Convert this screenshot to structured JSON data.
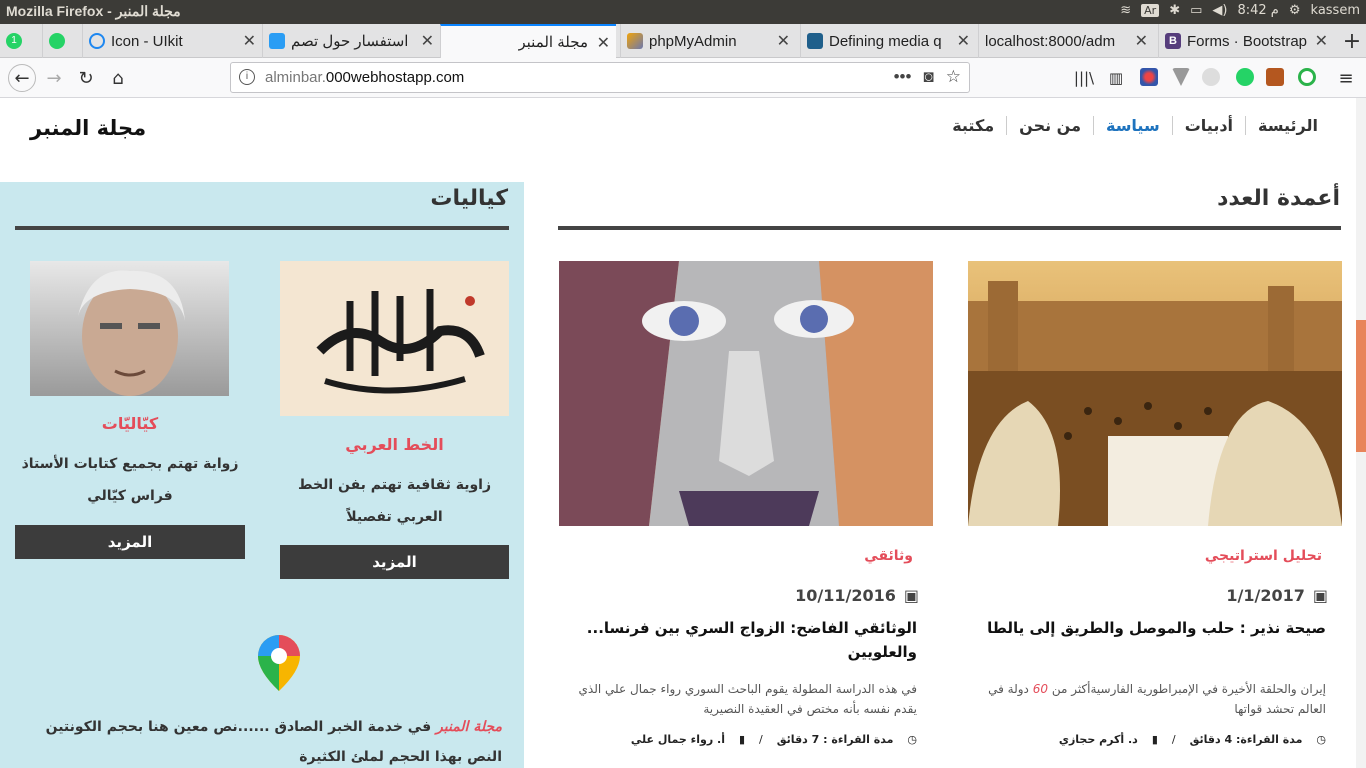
{
  "os": {
    "window_title": "Mozilla Firefox - مجلة المنبر",
    "keyboard": "Ar",
    "time": "8:42 م",
    "user": "kassem"
  },
  "tabs": [
    {
      "label": "",
      "color": "#25d366"
    },
    {
      "label": "",
      "color": "#25d366"
    },
    {
      "label": "Icon - UIkit",
      "color": "#1e87f0"
    },
    {
      "label": "استفسار حول تصم",
      "color": "#2a9df4"
    },
    {
      "label": "مجلة المنبر",
      "color": "#f9f9fa"
    },
    {
      "label": "phpMyAdmin",
      "color": "#f0a30a"
    },
    {
      "label": "Defining media q",
      "color": "#1f5f8b"
    },
    {
      "label": "localhost:8000/adm",
      "color": "#e3e3e4"
    },
    {
      "label": "Forms · Bootstrap",
      "color": "#563d7c"
    }
  ],
  "url": {
    "prefix": "alminbar.",
    "domain": "000webhostapp.com"
  },
  "site": {
    "logo": "مجلة المنبر",
    "menu": [
      "الرئيسة",
      "أدبيات",
      "سياسة",
      "من نحن",
      "مكتبة"
    ],
    "active_menu": "سياسة"
  },
  "sidebar": {
    "title": "كياليات",
    "cards": [
      {
        "title": "الخط العربي",
        "desc": "زاوية ثقافية تهتم بفن الخط العربي تفصيلاً",
        "more": "المزيد"
      },
      {
        "title": "كيّاليّات",
        "desc": "زواية تهتم بجميع كتابات الأستاذ فراس كيّالي",
        "more": "المزيد"
      }
    ],
    "footer_brand": "مجلة المنبر",
    "footer_text": " في خدمة الخبر الصادق ......نص معين هنا بحجم الكونتين النص بهذا الحجم لملئ الكثيرة"
  },
  "main": {
    "title": "أعمدة العدد",
    "posts": [
      {
        "category": "تحليل استراتيجي",
        "date": "1/1/2017",
        "title": "صيحة نذير : حلب والموصل والطريق إلى يالطا",
        "excerpt_pre": "إيران والحلقة الأخيرة في الإمبراطورية الفارسيةأكثر من ",
        "excerpt_num": "60",
        "excerpt_post": " دولة في العالم تحشد قواتها",
        "read_time": "مدة القراءة: 4 دقائق",
        "author": "د. أكرم حجازي",
        "sep": "/"
      },
      {
        "category": "وثائقي",
        "date": "10/11/2016",
        "title": "الوثائقي الفاضح: الزواج السري بين فرنسا... والعلويين",
        "excerpt_pre": "في هذه الدراسة المطولة يقوم الباحث السوري رواء جمال علي الذي يقدم نفسه بأنه مختص في العقيدة النصيرية",
        "excerpt_num": "",
        "excerpt_post": "",
        "read_time": "مدة القراءة : 7 دقائق",
        "author": "أ. رواء جمال علي",
        "sep": "/"
      }
    ]
  },
  "colors": {
    "accent": "#e44d5a",
    "active_link": "#1e73be",
    "sidebar_bg": "#c9e8ee",
    "button_bg": "#3c3c3c"
  }
}
